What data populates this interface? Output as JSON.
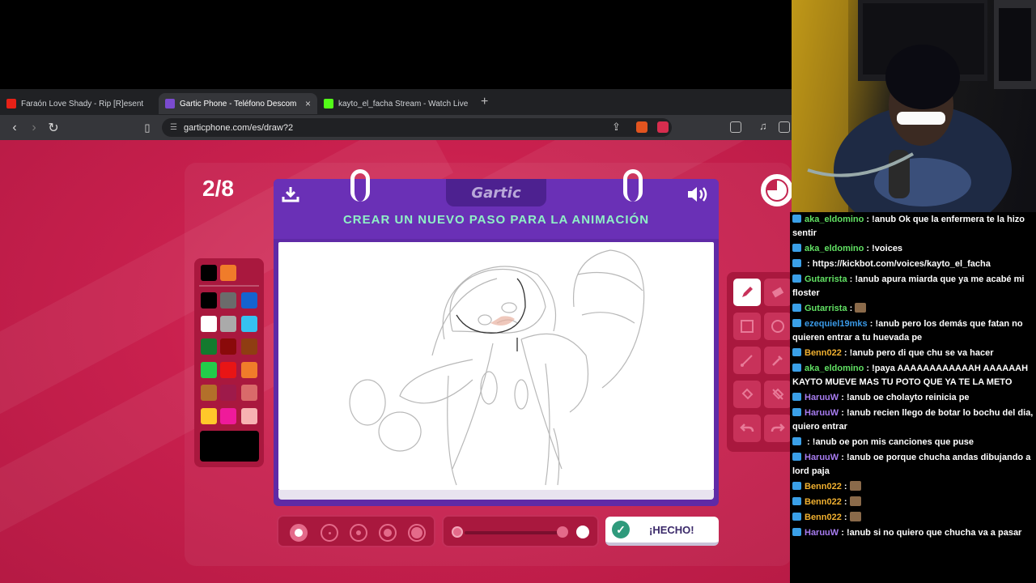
{
  "browser": {
    "tabs": [
      {
        "label": "Faraón Love Shady - Rip [R]esent",
        "icon": "youtube-icon",
        "active": false
      },
      {
        "label": "Gartic Phone - Teléfono Descom",
        "icon": "gartic-icon",
        "active": true
      },
      {
        "label": "kayto_el_facha Stream - Watch Live o",
        "icon": "kick-icon",
        "active": false
      }
    ],
    "new_tab": "+",
    "close": "×",
    "url": "garticphone.com/es/draw?2"
  },
  "game": {
    "round": "2/8",
    "logo": "Gartic",
    "title": "CREAR UN NUEVO PASO PARA LA ANIMACIÓN",
    "done_label": "¡HECHO!",
    "palette": [
      "#000000",
      "#f07c2a",
      "#000000",
      "#6b6b6b",
      "#1463cf",
      "#ffffff",
      "#aaaaaa",
      "#35c1f0",
      "#137a2e",
      "#8a0a0a",
      "#8f3d12",
      "#22cc4a",
      "#e81515",
      "#f07c2a",
      "#b3702a",
      "#9e1a4a",
      "#d96a6a",
      "#ffc82a",
      "#ef1a9a",
      "#f7b2b2"
    ],
    "selected_color": "#000000",
    "accent": "#8ff0c6"
  },
  "chat": [
    {
      "user": "aka_eldomino",
      "color": "#61e063",
      "text": "!anub Ok que la enfermera te la hizo sentir"
    },
    {
      "user": "aka_eldomino",
      "color": "#61e063",
      "text": "!voices"
    },
    {
      "user": "",
      "color": "#e03a3a",
      "text": "https://kickbot.com/voices/kayto_el_facha"
    },
    {
      "user": "Gutarrista",
      "color": "#61e063",
      "text": "!anub apura miarda que ya me acabé mi floster"
    },
    {
      "user": "Gutarrista",
      "color": "#61e063",
      "text": ""
    },
    {
      "user": "ezequiel19mks",
      "color": "#3a9ae8",
      "text": "!anub pero los demás que fatan no quieren entrar a tu huevada pe"
    },
    {
      "user": "Benn022",
      "color": "#f0b030",
      "text": "!anub pero di que chu se va hacer"
    },
    {
      "user": "aka_eldomino",
      "color": "#61e063",
      "text": "!paya AAAAAAAAAAAAH AAAAAAH KAYTO MUEVE MAS TU POTO QUE YA TE LA METO"
    },
    {
      "user": "HaruuW",
      "color": "#a77cf0",
      "text": "!anub oe cholayto reinicia pe"
    },
    {
      "user": "HaruuW",
      "color": "#a77cf0",
      "text": "!anub recien llego de botar lo bochu del dia, quiero entrar"
    },
    {
      "user": "",
      "color": "#e03a3a",
      "text": "!anub oe pon mis canciones que puse"
    },
    {
      "user": "HaruuW",
      "color": "#a77cf0",
      "text": "!anub oe porque chucha andas dibujando a lord paja"
    },
    {
      "user": "Benn022",
      "color": "#f0b030",
      "text": ""
    },
    {
      "user": "Benn022",
      "color": "#f0b030",
      "text": ""
    },
    {
      "user": "Benn022",
      "color": "#f0b030",
      "text": ""
    },
    {
      "user": "HaruuW",
      "color": "#a77cf0",
      "text": "!anub si no quiero que chucha va a pasar"
    }
  ]
}
